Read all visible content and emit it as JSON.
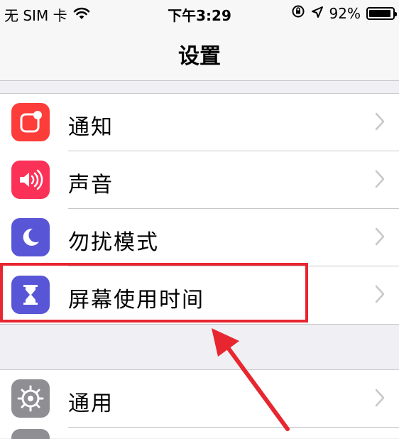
{
  "status_bar": {
    "carrier": "无 SIM 卡",
    "time": "下午3:29",
    "battery": "92%",
    "icons": [
      "wifi-icon",
      "orientation-lock-icon",
      "location-arrow-icon",
      "battery-icon"
    ]
  },
  "nav": {
    "title": "设置"
  },
  "settings": {
    "group1": [
      {
        "label": "通知",
        "icon": "notifications-icon",
        "color": "#fc3d39"
      },
      {
        "label": "声音",
        "icon": "sounds-icon",
        "color": "#fc3158"
      },
      {
        "label": "勿扰模式",
        "icon": "moon-icon",
        "color": "#5856d6"
      },
      {
        "label": "屏幕使用时间",
        "icon": "hourglass-icon",
        "color": "#5856d6"
      }
    ],
    "group2": [
      {
        "label": "通用",
        "icon": "gear-icon",
        "color": "#8e8e93"
      }
    ]
  },
  "annotation": {
    "highlight_color": "#e8262f",
    "highlighted_item": "屏幕使用时间"
  }
}
